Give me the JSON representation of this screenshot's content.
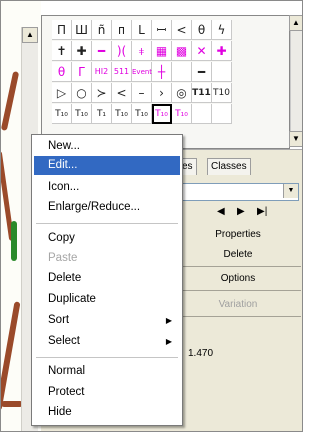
{
  "palette": {
    "row1": [
      "Π",
      "Ш",
      "ñ",
      "ᴨ",
      "L",
      "ꟷ",
      "<",
      "θ",
      "ϟ"
    ],
    "row2": [
      "✝",
      "✚",
      "━",
      ")(",
      "⧧",
      "▦",
      "▩",
      "✕",
      "✚"
    ],
    "row3": [
      "θ",
      "Γ",
      "HI2",
      "511",
      "Event",
      "┼",
      "",
      "━",
      ""
    ],
    "row4": [
      "▷",
      "○",
      "≻",
      "<",
      "–",
      "›",
      "◎",
      "T11",
      "T10"
    ],
    "row5": [
      "T₁₀",
      "T₁₀",
      "T₁",
      "T₁₀",
      "T₁₀",
      "T₁₀",
      "T₁₀",
      "",
      ""
    ]
  },
  "panel": {
    "tab_layers": "ses",
    "tab_classes": "Classes",
    "properties_label": "Properties",
    "delete_label": "Delete",
    "options_label": "Options",
    "variation_label": "Variation",
    "scale_value": "1.470"
  },
  "menu": {
    "items": [
      {
        "label": "New..."
      },
      {
        "label": "Edit..."
      },
      {
        "label": "Icon..."
      },
      {
        "label": "Enlarge/Reduce..."
      },
      {
        "label": "Copy"
      },
      {
        "label": "Paste"
      },
      {
        "label": "Delete"
      },
      {
        "label": "Duplicate"
      },
      {
        "label": "Sort"
      },
      {
        "label": "Select"
      },
      {
        "label": "Normal"
      },
      {
        "label": "Protect"
      },
      {
        "label": "Hide"
      }
    ]
  }
}
